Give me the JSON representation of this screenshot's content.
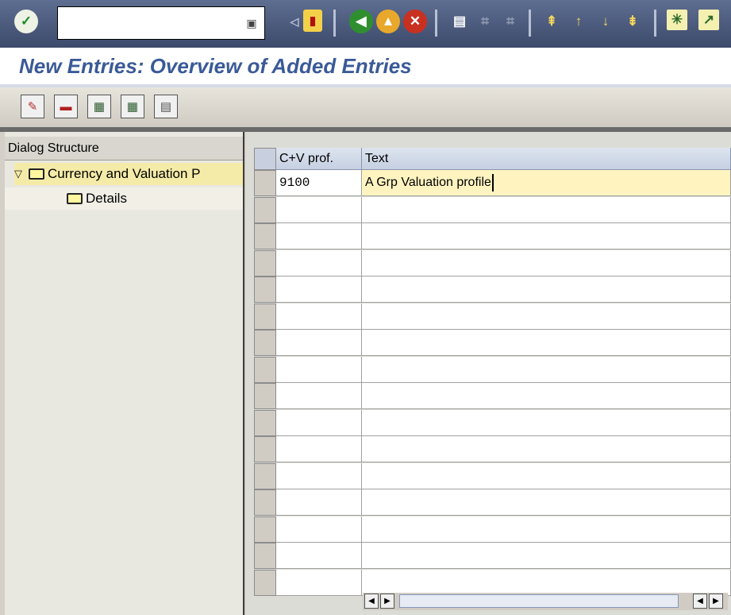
{
  "toolbar": {
    "okcode_value": "",
    "icons": [
      "enter-icon",
      "save-icon",
      "back-icon",
      "exit-icon",
      "cancel-icon",
      "print-icon",
      "find-icon",
      "find-next-icon",
      "first-page-icon",
      "previous-page-icon",
      "next-page-icon",
      "last-page-icon",
      "create-session-icon"
    ]
  },
  "title": "New Entries: Overview of Added Entries",
  "dialog_structure": {
    "header": "Dialog Structure",
    "items": [
      {
        "label": "Currency and Valuation P"
      },
      {
        "label": "Details"
      }
    ]
  },
  "table": {
    "columns": [
      "C+V prof.",
      "Text"
    ],
    "rows": [
      {
        "prof": "9100",
        "text": "A Grp Valuation profile"
      }
    ]
  }
}
